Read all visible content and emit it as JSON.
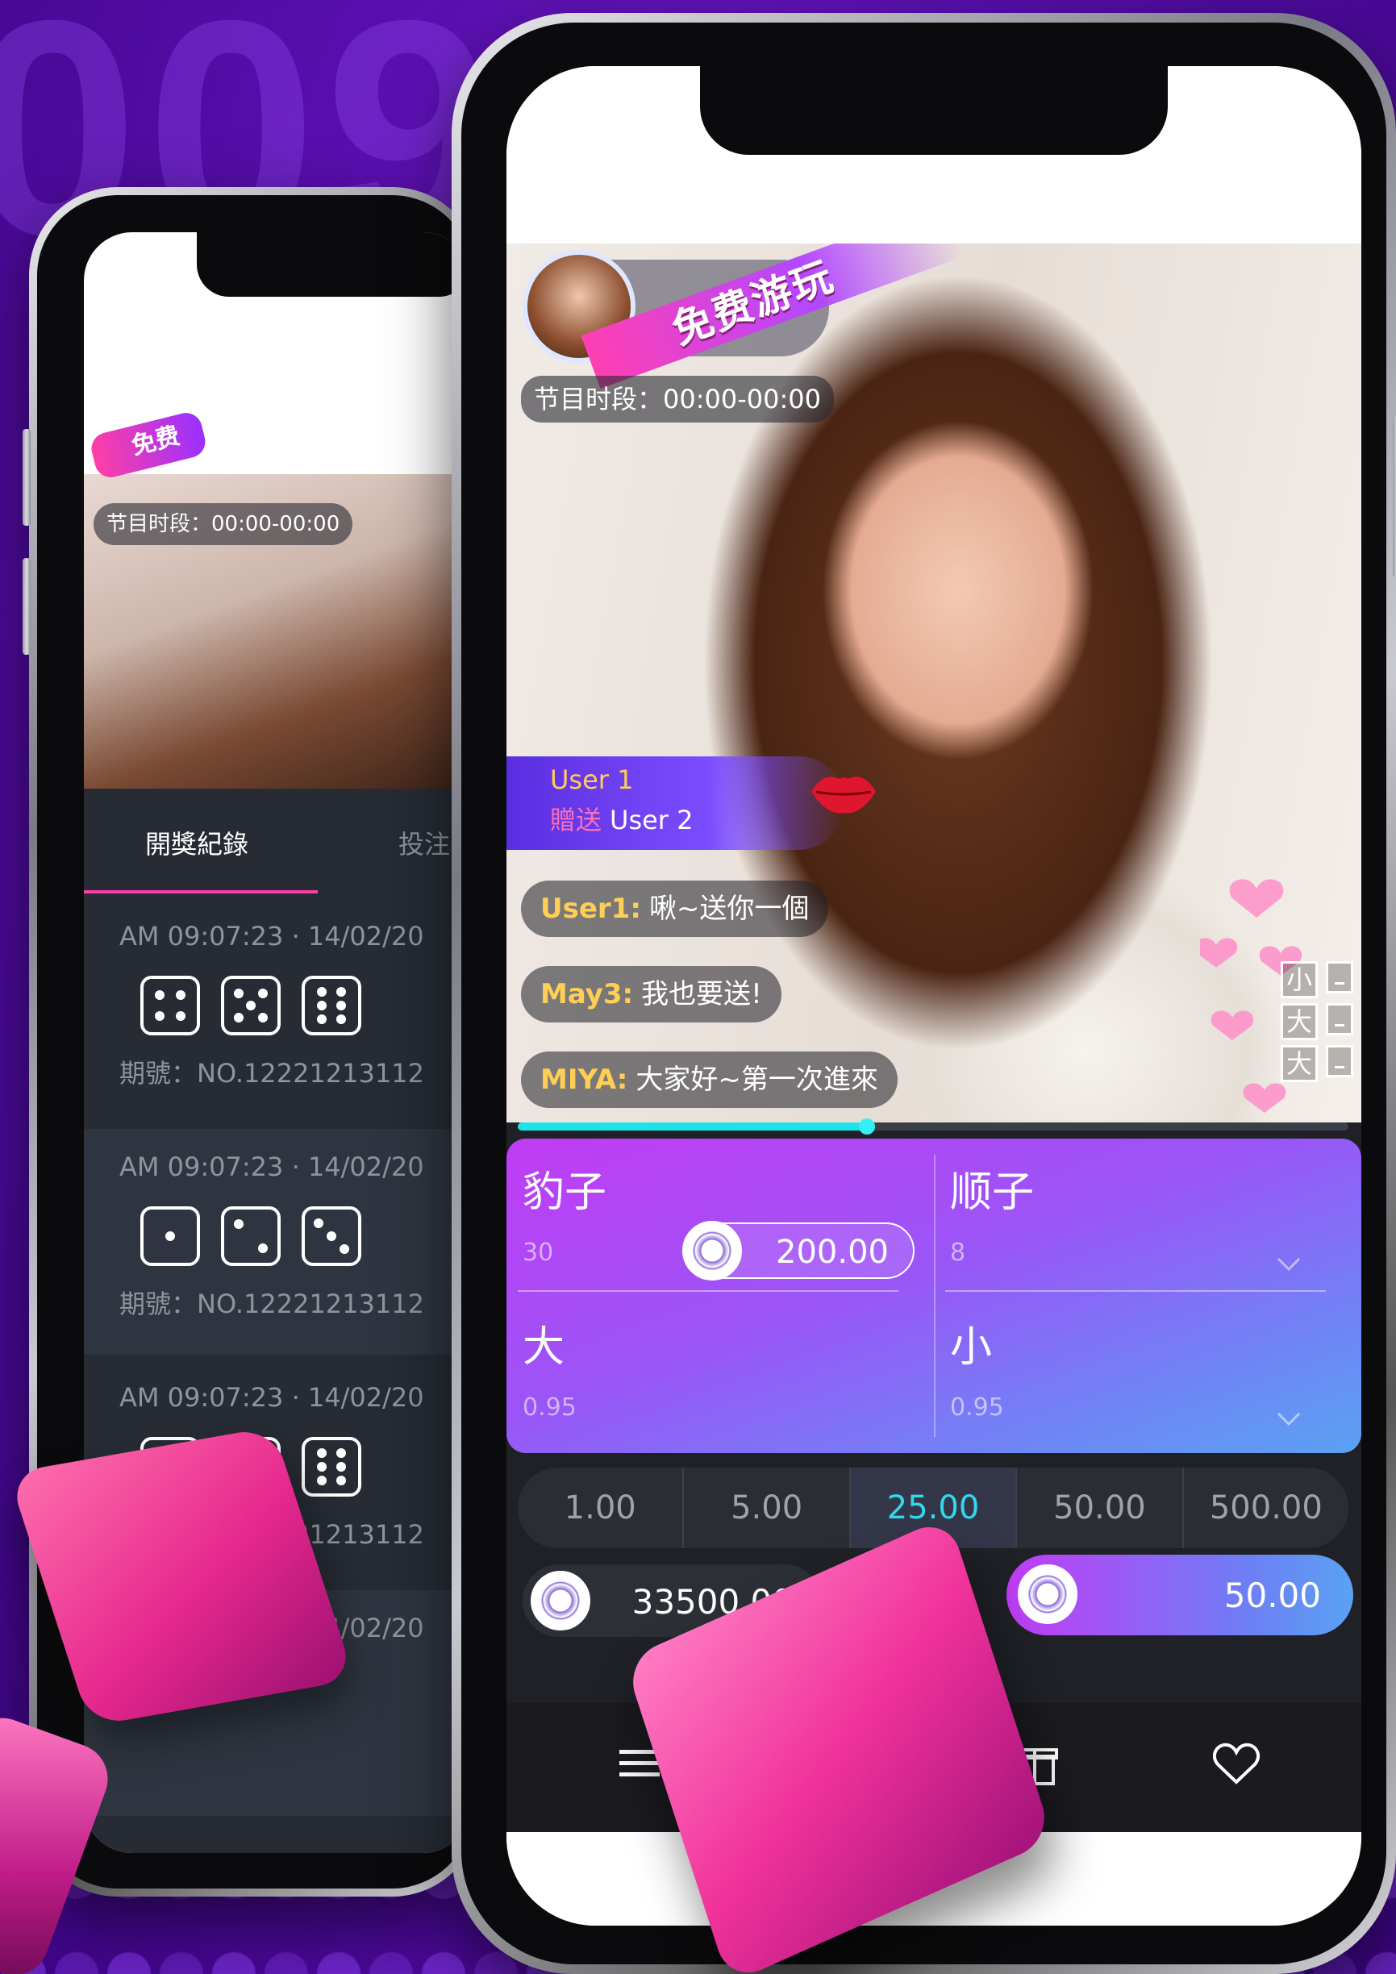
{
  "background": {
    "digits": "0091",
    "color": "#5a0fb0"
  },
  "back_phone": {
    "badge": "免费",
    "program_time": "节目时段：00:00-00:00",
    "tabs": [
      "開獎紀錄",
      "投注"
    ],
    "records": [
      {
        "time": "AM 09:07:23 · 14/02/20",
        "dice": [
          4,
          5,
          6
        ],
        "period": "期號：NO.12221213112"
      },
      {
        "time": "AM 09:07:23 · 14/02/20",
        "dice": [
          1,
          2,
          3
        ],
        "period": "期號：NO.12221213112"
      },
      {
        "time": "AM 09:07:23 · 14/02/20",
        "dice": [
          4,
          5,
          6
        ],
        "period": "期號：NO.12221213112"
      },
      {
        "time": "AM 09:07:23 · 14/02/20"
      }
    ]
  },
  "live": {
    "free_badge": "免费游玩",
    "program_time": "节目时段：00:00-00:00",
    "gift": {
      "from": "User 1",
      "verb": "贈送",
      "to": "User 2",
      "icon": "kiss-lips-icon"
    },
    "chat": [
      {
        "user": "User1:",
        "text": "啾~送你一個"
      },
      {
        "user": "May3:",
        "text": "我也要送!"
      },
      {
        "user": "MIYA:",
        "text": "大家好~第一次進來"
      }
    ],
    "mini_board": [
      "小",
      "大",
      "大"
    ]
  },
  "game": {
    "progress": 0.42,
    "bets": [
      {
        "name": "豹子",
        "odds": "30",
        "stake": "200.00"
      },
      {
        "name": "顺子",
        "odds": "8"
      },
      {
        "name": "大",
        "odds": "0.95"
      },
      {
        "name": "小",
        "odds": "0.95"
      }
    ],
    "chips": [
      "1.00",
      "5.00",
      "25.00",
      "50.00",
      "500.00"
    ],
    "active_chip": "25.00",
    "balance": "33500.00",
    "total_bet": "50.00",
    "nav_icons": [
      "menu-icon",
      "gift-icon",
      "heart-icon"
    ],
    "accent": "#32d9ee",
    "board_gradient": [
      "#c13cf5",
      "#5aa2f4"
    ]
  }
}
